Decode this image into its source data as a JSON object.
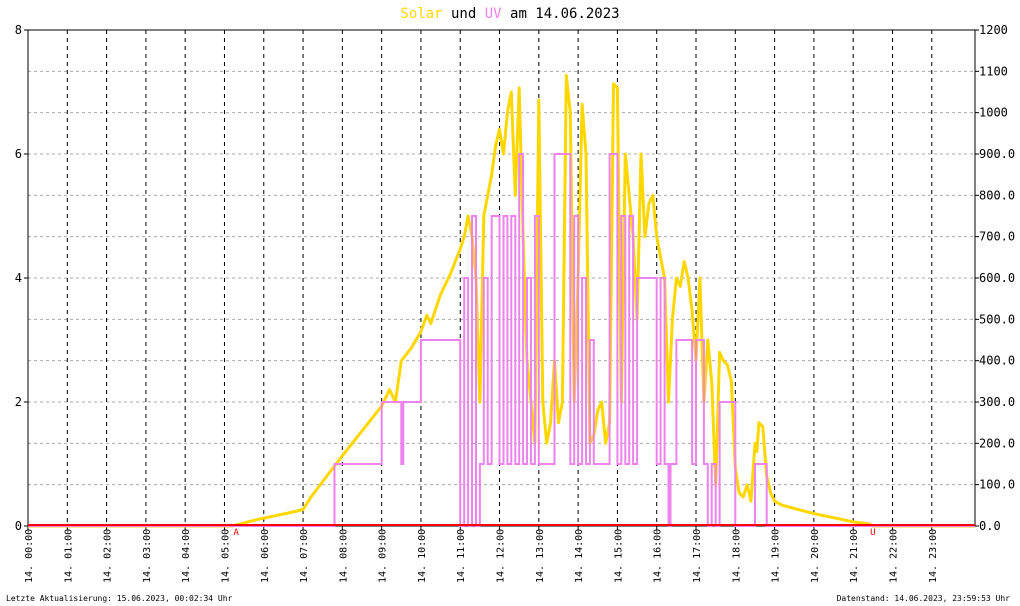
{
  "header": {
    "title_solar": "Solar",
    "title_und": "und",
    "title_uv": "UV",
    "title_rest": "am 14.06.2023"
  },
  "footer": {
    "left": "Letzte Aktualisierung: 15.06.2023, 00:02:34 Uhr",
    "right": "Datenstand: 14.06.2023, 23:59:53 Uhr"
  },
  "markers": {
    "sunrise": "A",
    "sunset": "U"
  },
  "chart_data": {
    "type": "line",
    "colors": {
      "solar": "#ffd700",
      "uv": "#ee82ee",
      "baseline": "#ff0000",
      "marker": "#ff0000"
    },
    "x_unit": "hour of day",
    "xlim": [
      0,
      24.1
    ],
    "x_ticks": [
      "14. 00:00",
      "14. 01:00",
      "14. 02:00",
      "14. 03:00",
      "14. 04:00",
      "14. 05:00",
      "14. 06:00",
      "14. 07:00",
      "14. 08:00",
      "14. 09:00",
      "14. 10:00",
      "14. 11:00",
      "14. 12:00",
      "14. 13:00",
      "14. 14:00",
      "14. 15:00",
      "14. 16:00",
      "14. 17:00",
      "14. 18:00",
      "14. 19:00",
      "14. 20:00",
      "14. 21:00",
      "14. 22:00",
      "14. 23:00"
    ],
    "y_left": {
      "ticks": [
        "0",
        "2",
        "4",
        "6",
        "8"
      ],
      "range": [
        0,
        8
      ]
    },
    "y_right": {
      "ticks": [
        "0.0",
        "100.0",
        "200.0",
        "300.0",
        "400.0",
        "500.0",
        "600.0",
        "700.0",
        "800.0",
        "900.0",
        "1000",
        "1100",
        "1200"
      ],
      "range": [
        0,
        1200
      ]
    },
    "grid": true,
    "marker_hours": {
      "sunrise": 5.3,
      "sunset": 21.5
    },
    "series": [
      {
        "name": "Solar",
        "axis": "right",
        "points": [
          [
            0,
            0
          ],
          [
            5.2,
            0
          ],
          [
            5.4,
            5
          ],
          [
            5.8,
            15
          ],
          [
            6.3,
            25
          ],
          [
            6.8,
            35
          ],
          [
            7.0,
            40
          ],
          [
            7.2,
            70
          ],
          [
            7.6,
            120
          ],
          [
            8.0,
            170
          ],
          [
            8.5,
            230
          ],
          [
            9.0,
            290
          ],
          [
            9.2,
            330
          ],
          [
            9.35,
            300
          ],
          [
            9.5,
            400
          ],
          [
            9.75,
            430
          ],
          [
            10.0,
            470
          ],
          [
            10.15,
            510
          ],
          [
            10.25,
            490
          ],
          [
            10.5,
            560
          ],
          [
            10.75,
            610
          ],
          [
            11.0,
            670
          ],
          [
            11.1,
            700
          ],
          [
            11.2,
            750
          ],
          [
            11.3,
            700
          ],
          [
            11.4,
            600
          ],
          [
            11.5,
            300
          ],
          [
            11.6,
            750
          ],
          [
            11.7,
            800
          ],
          [
            11.8,
            850
          ],
          [
            11.9,
            920
          ],
          [
            12.0,
            960
          ],
          [
            12.1,
            900
          ],
          [
            12.2,
            1000
          ],
          [
            12.3,
            1050
          ],
          [
            12.4,
            800
          ],
          [
            12.5,
            1060
          ],
          [
            12.6,
            700
          ],
          [
            12.7,
            400
          ],
          [
            12.8,
            300
          ],
          [
            12.9,
            200
          ],
          [
            13.0,
            1030
          ],
          [
            13.1,
            300
          ],
          [
            13.2,
            200
          ],
          [
            13.3,
            250
          ],
          [
            13.4,
            400
          ],
          [
            13.5,
            250
          ],
          [
            13.6,
            300
          ],
          [
            13.7,
            1090
          ],
          [
            13.8,
            1000
          ],
          [
            13.9,
            300
          ],
          [
            14.0,
            600
          ],
          [
            14.1,
            1020
          ],
          [
            14.2,
            900
          ],
          [
            14.3,
            200
          ],
          [
            14.4,
            220
          ],
          [
            14.5,
            280
          ],
          [
            14.6,
            300
          ],
          [
            14.7,
            200
          ],
          [
            14.8,
            250
          ],
          [
            14.9,
            1070
          ],
          [
            15.0,
            1060
          ],
          [
            15.1,
            300
          ],
          [
            15.2,
            900
          ],
          [
            15.3,
            800
          ],
          [
            15.4,
            700
          ],
          [
            15.5,
            500
          ],
          [
            15.6,
            900
          ],
          [
            15.7,
            700
          ],
          [
            15.8,
            780
          ],
          [
            15.9,
            800
          ],
          [
            16.0,
            700
          ],
          [
            16.1,
            650
          ],
          [
            16.2,
            600
          ],
          [
            16.3,
            300
          ],
          [
            16.4,
            500
          ],
          [
            16.5,
            600
          ],
          [
            16.6,
            580
          ],
          [
            16.7,
            640
          ],
          [
            16.8,
            600
          ],
          [
            16.9,
            520
          ],
          [
            17.0,
            400
          ],
          [
            17.1,
            600
          ],
          [
            17.2,
            300
          ],
          [
            17.3,
            450
          ],
          [
            17.4,
            350
          ],
          [
            17.5,
            100
          ],
          [
            17.6,
            420
          ],
          [
            17.7,
            400
          ],
          [
            17.8,
            390
          ],
          [
            17.9,
            350
          ],
          [
            18.0,
            140
          ],
          [
            18.1,
            80
          ],
          [
            18.2,
            70
          ],
          [
            18.3,
            100
          ],
          [
            18.4,
            60
          ],
          [
            18.5,
            200
          ],
          [
            18.55,
            180
          ],
          [
            18.6,
            250
          ],
          [
            18.7,
            240
          ],
          [
            18.8,
            120
          ],
          [
            18.9,
            80
          ],
          [
            19.0,
            60
          ],
          [
            19.2,
            50
          ],
          [
            19.6,
            40
          ],
          [
            20.0,
            30
          ],
          [
            20.5,
            20
          ],
          [
            21.0,
            10
          ],
          [
            21.4,
            5
          ],
          [
            21.5,
            0
          ],
          [
            24.1,
            0
          ]
        ]
      },
      {
        "name": "UV",
        "axis": "left",
        "points": [
          [
            0,
            0
          ],
          [
            7.8,
            0
          ],
          [
            7.8,
            1
          ],
          [
            9.0,
            1
          ],
          [
            9.0,
            2
          ],
          [
            9.5,
            2
          ],
          [
            9.5,
            1
          ],
          [
            9.55,
            1
          ],
          [
            9.55,
            2
          ],
          [
            10.0,
            2
          ],
          [
            10.0,
            3
          ],
          [
            11.0,
            3
          ],
          [
            11.0,
            0
          ],
          [
            11.1,
            0
          ],
          [
            11.1,
            4
          ],
          [
            11.2,
            4
          ],
          [
            11.2,
            0
          ],
          [
            11.3,
            0
          ],
          [
            11.3,
            5
          ],
          [
            11.4,
            5
          ],
          [
            11.4,
            0
          ],
          [
            11.5,
            0
          ],
          [
            11.5,
            1
          ],
          [
            11.6,
            1
          ],
          [
            11.6,
            4
          ],
          [
            11.7,
            4
          ],
          [
            11.7,
            1
          ],
          [
            11.8,
            1
          ],
          [
            11.8,
            5
          ],
          [
            12.0,
            5
          ],
          [
            12.0,
            1
          ],
          [
            12.1,
            1
          ],
          [
            12.1,
            5
          ],
          [
            12.2,
            5
          ],
          [
            12.2,
            1
          ],
          [
            12.3,
            1
          ],
          [
            12.3,
            5
          ],
          [
            12.4,
            5
          ],
          [
            12.4,
            1
          ],
          [
            12.5,
            1
          ],
          [
            12.5,
            6
          ],
          [
            12.6,
            6
          ],
          [
            12.6,
            1
          ],
          [
            12.7,
            1
          ],
          [
            12.7,
            4
          ],
          [
            12.8,
            4
          ],
          [
            12.8,
            1
          ],
          [
            12.9,
            1
          ],
          [
            12.9,
            5
          ],
          [
            13.0,
            5
          ],
          [
            13.0,
            1
          ],
          [
            13.4,
            1
          ],
          [
            13.4,
            6
          ],
          [
            13.8,
            6
          ],
          [
            13.8,
            1
          ],
          [
            13.9,
            1
          ],
          [
            13.9,
            5
          ],
          [
            14.0,
            5
          ],
          [
            14.0,
            1
          ],
          [
            14.1,
            1
          ],
          [
            14.1,
            4
          ],
          [
            14.2,
            4
          ],
          [
            14.2,
            1
          ],
          [
            14.3,
            1
          ],
          [
            14.3,
            3
          ],
          [
            14.4,
            3
          ],
          [
            14.4,
            1
          ],
          [
            14.8,
            1
          ],
          [
            14.8,
            6
          ],
          [
            15.0,
            6
          ],
          [
            15.0,
            1
          ],
          [
            15.1,
            1
          ],
          [
            15.1,
            5
          ],
          [
            15.2,
            5
          ],
          [
            15.2,
            1
          ],
          [
            15.3,
            1
          ],
          [
            15.3,
            5
          ],
          [
            15.4,
            5
          ],
          [
            15.4,
            1
          ],
          [
            15.5,
            1
          ],
          [
            15.5,
            4
          ],
          [
            16.0,
            4
          ],
          [
            16.0,
            1
          ],
          [
            16.1,
            1
          ],
          [
            16.1,
            4
          ],
          [
            16.2,
            4
          ],
          [
            16.2,
            1
          ],
          [
            16.3,
            1
          ],
          [
            16.3,
            0
          ],
          [
            16.35,
            0
          ],
          [
            16.35,
            1
          ],
          [
            16.5,
            1
          ],
          [
            16.5,
            3
          ],
          [
            16.9,
            3
          ],
          [
            16.9,
            1
          ],
          [
            17.0,
            1
          ],
          [
            17.0,
            3
          ],
          [
            17.2,
            3
          ],
          [
            17.2,
            1
          ],
          [
            17.3,
            1
          ],
          [
            17.3,
            0
          ],
          [
            17.4,
            0
          ],
          [
            17.4,
            1
          ],
          [
            17.5,
            1
          ],
          [
            17.5,
            0
          ],
          [
            17.6,
            0
          ],
          [
            17.6,
            2
          ],
          [
            18.0,
            2
          ],
          [
            18.0,
            0
          ],
          [
            18.5,
            0
          ],
          [
            18.5,
            1
          ],
          [
            18.8,
            1
          ],
          [
            18.8,
            0
          ],
          [
            24.1,
            0
          ]
        ]
      }
    ]
  }
}
